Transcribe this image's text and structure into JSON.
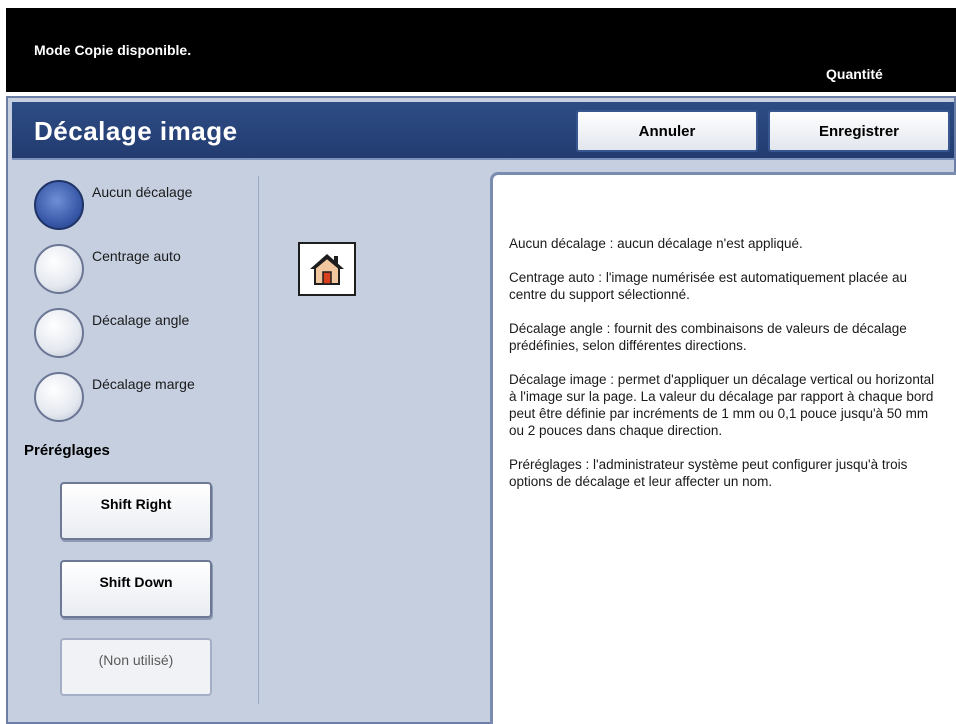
{
  "status_bar": {
    "message": "Mode Copie disponible.",
    "quantity_label": "Quantité"
  },
  "header": {
    "title": "Décalage image",
    "cancel_label": "Annuler",
    "save_label": "Enregistrer"
  },
  "options": [
    {
      "label": "Aucun décalage",
      "selected": true
    },
    {
      "label": "Centrage auto",
      "selected": false
    },
    {
      "label": "Décalage angle",
      "selected": false
    },
    {
      "label": "Décalage marge",
      "selected": false
    }
  ],
  "presets": {
    "label": "Préréglages",
    "buttons": [
      {
        "label": "Shift Right",
        "enabled": true
      },
      {
        "label": "Shift Down",
        "enabled": true
      },
      {
        "label": "(Non utilisé)",
        "enabled": false
      }
    ]
  },
  "home_icon": "home-icon",
  "info": {
    "paragraphs": [
      "Aucun décalage : aucun décalage n'est appliqué.",
      "Centrage auto : l'image numérisée est automatiquement placée au centre du support sélectionné.",
      "Décalage angle : fournit des combinaisons de valeurs de décalage prédéfinies, selon différentes directions.",
      "Décalage image : permet d'appliquer un décalage vertical ou horizontal à l'image sur la page. La valeur du décalage par rapport à chaque bord peut être définie par incréments de 1 mm ou 0,1 pouce jusqu'à 50 mm ou 2 pouces dans chaque direction.",
      "Préréglages : l'administrateur système peut configurer jusqu'à trois options de décalage et leur affecter un nom."
    ]
  },
  "colors": {
    "header_bg": "#2e4c85",
    "panel_bg": "#c5cfe0",
    "selected_radio": "#3656a6"
  }
}
